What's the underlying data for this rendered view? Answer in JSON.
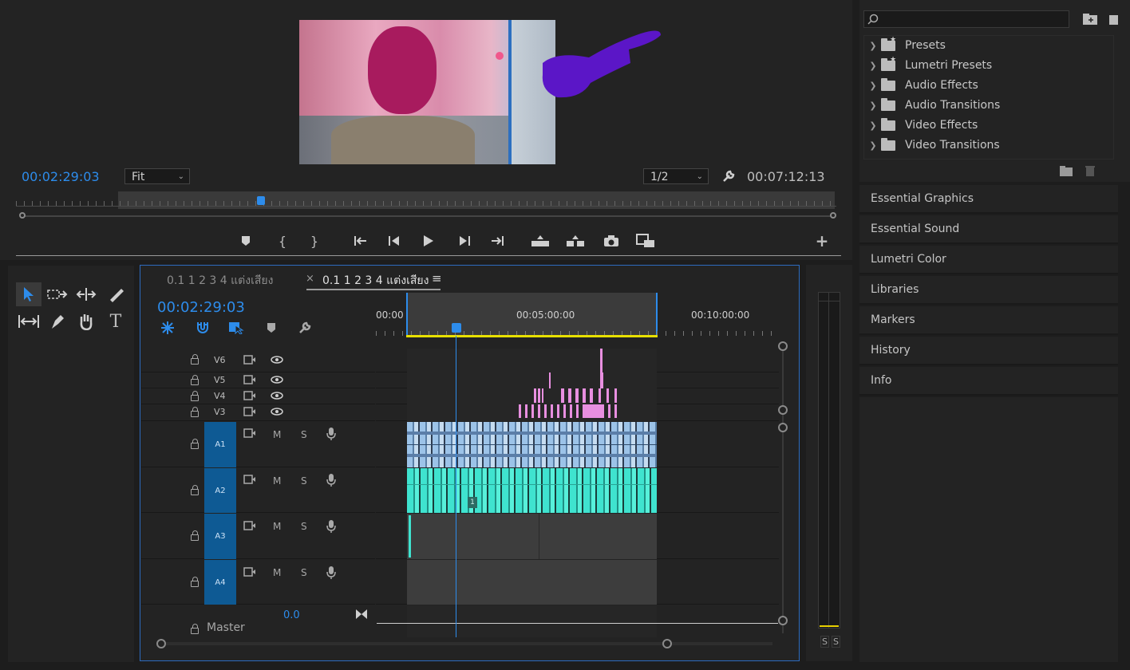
{
  "program_monitor": {
    "current_timecode": "00:02:29:03",
    "zoom": "Fit",
    "resolution": "1/2",
    "duration_timecode": "00:07:12:13"
  },
  "effects": {
    "search_placeholder": "",
    "items": [
      {
        "label": "Presets",
        "icon": "preset-folder-icon"
      },
      {
        "label": "Lumetri Presets",
        "icon": "preset-folder-icon"
      },
      {
        "label": "Audio Effects",
        "icon": "folder-icon"
      },
      {
        "label": "Audio Transitions",
        "icon": "folder-icon"
      },
      {
        "label": "Video Effects",
        "icon": "folder-icon"
      },
      {
        "label": "Video Transitions",
        "icon": "folder-icon"
      }
    ]
  },
  "side_panels": [
    {
      "label": "Essential Graphics"
    },
    {
      "label": "Essential Sound"
    },
    {
      "label": "Lumetri Color"
    },
    {
      "label": "Libraries"
    },
    {
      "label": "Markers"
    },
    {
      "label": "History"
    },
    {
      "label": "Info"
    }
  ],
  "timeline": {
    "tabs": [
      {
        "label": "0.1 1 2 3 4 แต่งเสียง",
        "active": false
      },
      {
        "label": "0.1 1 2 3 4 แต่งเสียง",
        "active": true
      }
    ],
    "close_glyph": "×",
    "menu_glyph": "≡",
    "current_timecode": "00:02:29:03",
    "ruler_labels": [
      "00:00",
      "00:05:00:00",
      "00:10:00:00"
    ],
    "video_tracks": [
      "V6",
      "V5",
      "V4",
      "V3"
    ],
    "audio_tracks": [
      {
        "name": "A1",
        "m": "M",
        "s": "S"
      },
      {
        "name": "A2",
        "m": "M",
        "s": "S"
      },
      {
        "name": "A3",
        "m": "M",
        "s": "S"
      },
      {
        "name": "A4",
        "m": "M",
        "s": "S"
      }
    ],
    "master_label": "Master",
    "master_value": "0.0",
    "clip_badge": "1"
  },
  "meter": {
    "solo_labels": [
      "S",
      "S"
    ]
  },
  "colors": {
    "accent": "#2d8ceb",
    "audio_clip_a1": "#9cc3e8",
    "audio_clip_a2": "#3fe3cf",
    "video_clip": "#e88fe0"
  }
}
